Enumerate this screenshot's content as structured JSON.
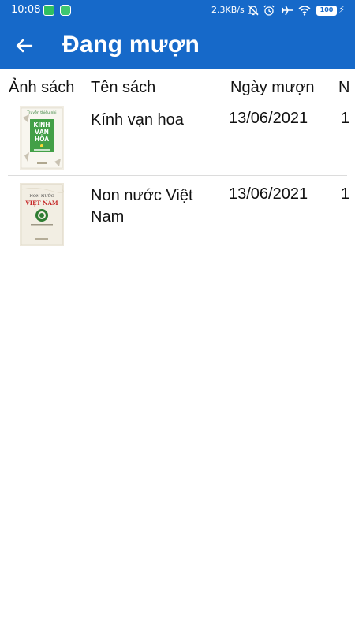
{
  "status_bar": {
    "time": "10:08",
    "network_speed": "2.3KB/s",
    "battery": "100",
    "icons": [
      "app-icon",
      "app-icon",
      "mute-bell-icon",
      "alarm-icon",
      "airplane-icon",
      "wifi-icon",
      "battery-icon",
      "charging-icon"
    ]
  },
  "app_bar": {
    "title": "Đang mượn",
    "back_icon": "arrow-left-icon",
    "color": "#1669c9"
  },
  "table": {
    "headers": [
      "Ảnh sách",
      "Tên sách",
      "Ngày mượn",
      "N"
    ],
    "rows": [
      {
        "cover": {
          "series": "Truyện thiếu nhi",
          "title_line1": "KÍNH",
          "title_line2": "VẠN",
          "title_line3": "HOA"
        },
        "name": "Kính vạn hoa",
        "date": "13/06/2021",
        "extra": "1"
      },
      {
        "cover": {
          "title_line1": "NON NƯỚC",
          "title_line2": "VIỆT NAM"
        },
        "name": "Non nước Việt Nam",
        "date": "13/06/2021",
        "extra": "1"
      }
    ]
  }
}
